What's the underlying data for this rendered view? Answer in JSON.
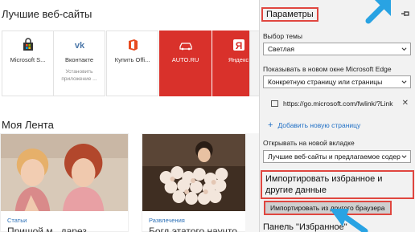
{
  "top_sites": {
    "title": "Лучшие веб-сайты",
    "tiles": [
      {
        "label": "Microsoft S...",
        "icon": "store-bag-icon"
      },
      {
        "label": "Вконтакте",
        "sub": "Установить приложение ...",
        "icon": "vk-icon"
      },
      {
        "label": "Купить Offi...",
        "icon": "office-icon"
      },
      {
        "label": "AUTO.RU",
        "icon": "auto-car-icon"
      },
      {
        "label": "Яндекс",
        "icon": "yandex-icon"
      }
    ]
  },
  "feed": {
    "title": "Моя Лента",
    "cards": [
      {
        "category": "Статьи",
        "headline": "Пришой м.. дарез"
      },
      {
        "category": "Развлечения",
        "headline": "Богд этатого научто"
      }
    ]
  },
  "settings": {
    "title": "Параметры",
    "theme_label": "Выбор темы",
    "theme_value": "Светлая",
    "open_with_label": "Показывать в новом окне Microsoft Edge",
    "open_with_value": "Конкретную страницу или страницы",
    "page_url": "https://go.microsoft.com/fwlink/?Link",
    "close_glyph": "✕",
    "add_page": "Добавить новую страницу",
    "plus_glyph": "+",
    "new_tab_label": "Открывать на новой вкладке",
    "new_tab_value": "Лучшие веб-сайты и предлагаемое содер",
    "import_title": "Импортировать избранное и другие данные",
    "import_button": "Импортировать из другого браузера",
    "favorites_bar": "Панель \"Избранное\""
  },
  "colors": {
    "highlight": "#e0463f",
    "link": "#1f6fc5",
    "arrow": "#29a3e3"
  }
}
